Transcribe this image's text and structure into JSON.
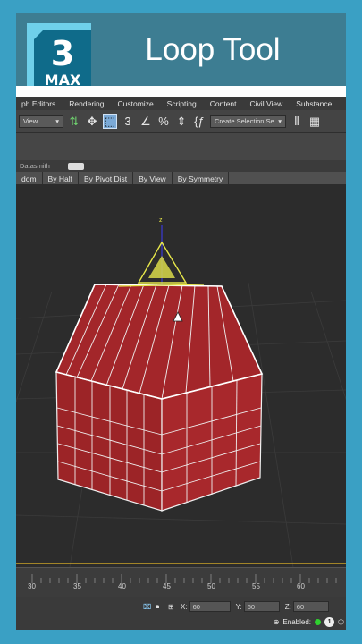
{
  "header": {
    "logo_number": "3",
    "logo_text": "MAX",
    "title": "Loop Tool"
  },
  "menu": [
    "ph Editors",
    "Rendering",
    "Customize",
    "Scripting",
    "Content",
    "Civil View",
    "Substance"
  ],
  "toolbar": {
    "view_select": "View",
    "selection_set": "Create Selection Se",
    "icon3": "3",
    "icon_percent": "%"
  },
  "ribbon": {
    "label": "Datasmith"
  },
  "subtabs": [
    "dom",
    "By Half",
    "By Pivot Dist",
    "By View",
    "By Symmetry"
  ],
  "timeline": {
    "labels": [
      "30",
      "35",
      "40",
      "45",
      "50",
      "55",
      "60"
    ]
  },
  "status": {
    "x_label": "X:",
    "x_value": "60",
    "y_label": "Y:",
    "y_value": "60",
    "z_label": "Z:",
    "z_value": "60",
    "enabled_label": "Enabled:",
    "enabled_count": "1"
  },
  "viewport": {
    "gizmo_axis": "z"
  },
  "colors": {
    "frame": "#3aa0c4",
    "header_band": "#3d7d92",
    "mesh": "#a3262a",
    "gizmo": "#d9d94a"
  }
}
